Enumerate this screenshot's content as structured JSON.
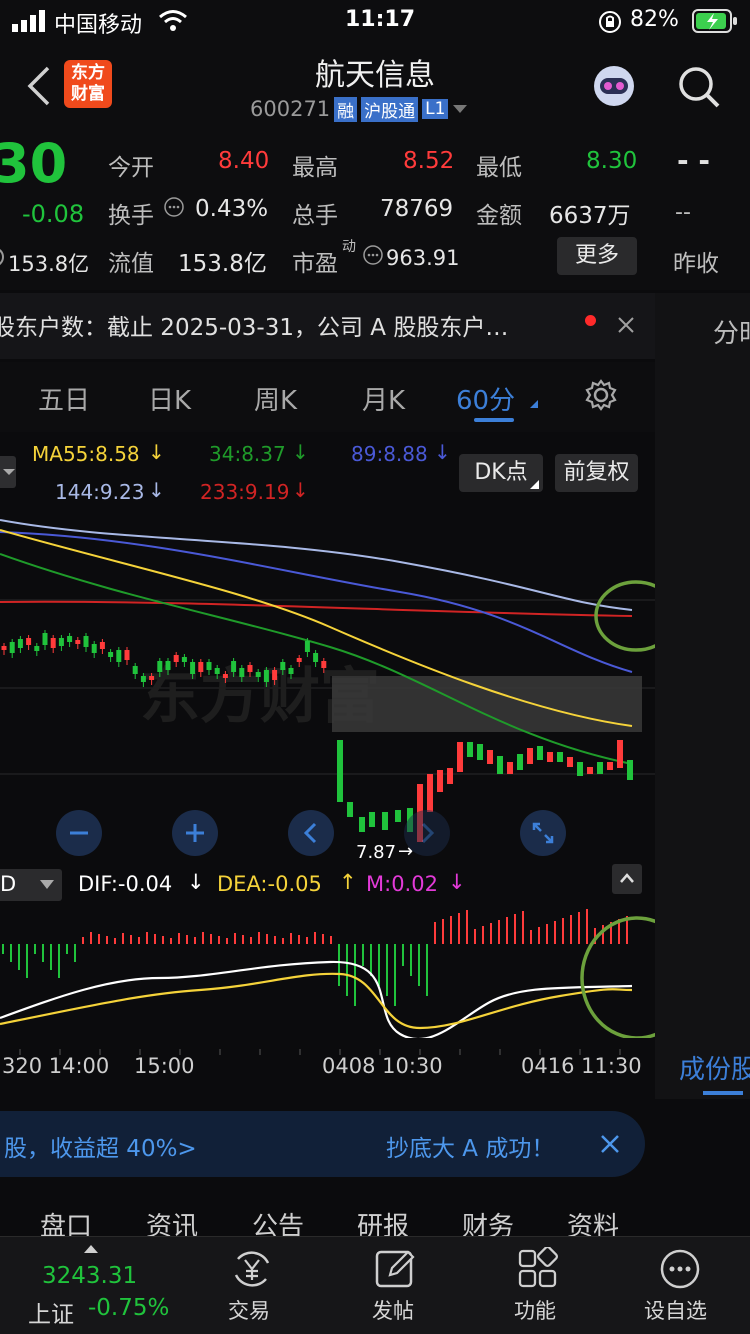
{
  "status": {
    "carrier": "中国移动",
    "time": "11:17",
    "battery": "82%"
  },
  "header": {
    "title": "航天信息",
    "code": "600271",
    "badge_rong": "融",
    "badge_hgt": "沪股通",
    "badge_level": "L1",
    "brand_line1": "东方",
    "brand_line2": "财富"
  },
  "quote": {
    "price_partial": "30",
    "change": "-0.08",
    "mktcap_partial": "153.8亿",
    "open_label": "今开",
    "open_value": "8.40",
    "high_label": "最高",
    "high_value": "8.52",
    "low_label": "最低",
    "low_value": "8.30",
    "turnover_label": "换手",
    "turnover_value": "0.43%",
    "volume_label": "总手",
    "volume_value": "78769",
    "amount_label": "金额",
    "amount_value": "6637万",
    "float_label": "流值",
    "float_value": "153.8亿",
    "pe_label": "市盈",
    "pe_sup": "动",
    "pe_value": "963.91",
    "more_label": "更多",
    "prevclose_label": "昨收",
    "prevclose_top": "- -",
    "prevclose_mid": "--"
  },
  "notice": {
    "text": "股东户数：截止 2025-03-31，公司 A 股股东户…"
  },
  "right_panel": {
    "top_label": "分时",
    "bottom_label": "成份股"
  },
  "tabs": [
    "五日",
    "日K",
    "周K",
    "月K",
    "60分"
  ],
  "ma": {
    "ma55": "MA55:8.58",
    "ma34": "34:8.37",
    "ma89": "89:8.88",
    "ma144": "144:9.23",
    "ma233": "233:9.19",
    "dk_label": "DK点",
    "fq_label": "前复权"
  },
  "chart": {
    "low_marker": "7.87"
  },
  "macd": {
    "ind_label": "D",
    "dif": "DIF:-0.04",
    "dea": "DEA:-0.05",
    "m": "M:0.02"
  },
  "x_axis": [
    "320 14:00",
    "15:00",
    "0408 10:30",
    "0416 11:30"
  ],
  "banner": {
    "left": "股，收益超 40%>",
    "right": "抄底大 A 成功！"
  },
  "f10_tabs": [
    "盘口",
    "资讯",
    "公告",
    "研报",
    "财务",
    "资料"
  ],
  "bottom": {
    "index_value": "3243.31",
    "index_name": "上证",
    "index_change": "-0.75%",
    "trade": "交易",
    "post": "发帖",
    "func": "功能",
    "watch": "设自选"
  },
  "colors": {
    "up": "#ff3b3b",
    "down": "#20c33c",
    "accent": "#3c7fd8",
    "ma55": "#f5d33a",
    "ma34": "#1f9b2a",
    "ma89": "#4a59d6",
    "ma144": "#a9b9e6",
    "ma233": "#d12424"
  }
}
